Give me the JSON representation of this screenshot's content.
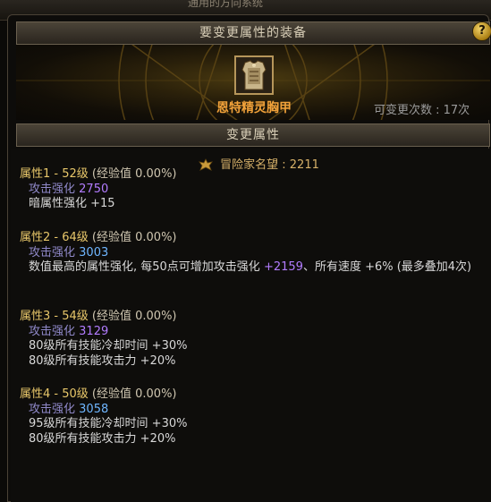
{
  "top_strip_text": "通用的方向系统",
  "header": {
    "title": "要变更属性的装备",
    "help_label": "?"
  },
  "item": {
    "name": "恩特精灵胸甲",
    "change_count": "可变更次数 : 17次"
  },
  "subheader": {
    "title": "变更属性"
  },
  "renown": {
    "text": "冒险家名望 : 2211"
  },
  "attributes": [
    {
      "title": "属性1 - 52级",
      "exp": "(经验值 0.00%)",
      "atk_label": "攻击强化",
      "atk_value": "2750",
      "lines": [
        "暗属性强化 +15"
      ]
    },
    {
      "title": "属性2 - 64级",
      "exp": "(经验值 0.00%)",
      "atk_label": "攻击强化",
      "atk_value": "3003",
      "long_pre": "数值最高的属性强化, 每50点可增加攻击强化 ",
      "long_val": "+2159",
      "long_post": "、所有速度 +6% (最多叠加4次)"
    },
    {
      "title": "属性3 - 54级",
      "exp": "(经验值 0.00%)",
      "atk_label": "攻击强化",
      "atk_value": "3129",
      "lines": [
        "80级所有技能冷却时间 +30%",
        "80级所有技能攻击力 +20%"
      ]
    },
    {
      "title": "属性4 - 50级",
      "exp": "(经验值 0.00%)",
      "atk_label": "攻击强化",
      "atk_value": "3058",
      "lines": [
        "95级所有技能冷却时间 +30%",
        "80级所有技能攻击力 +20%"
      ]
    }
  ],
  "colors": {
    "gold_title": "#e8c76a",
    "item_orange": "#f2a23a",
    "attack_purple": "#b27cff",
    "attack_blue": "#6fb6ff"
  }
}
